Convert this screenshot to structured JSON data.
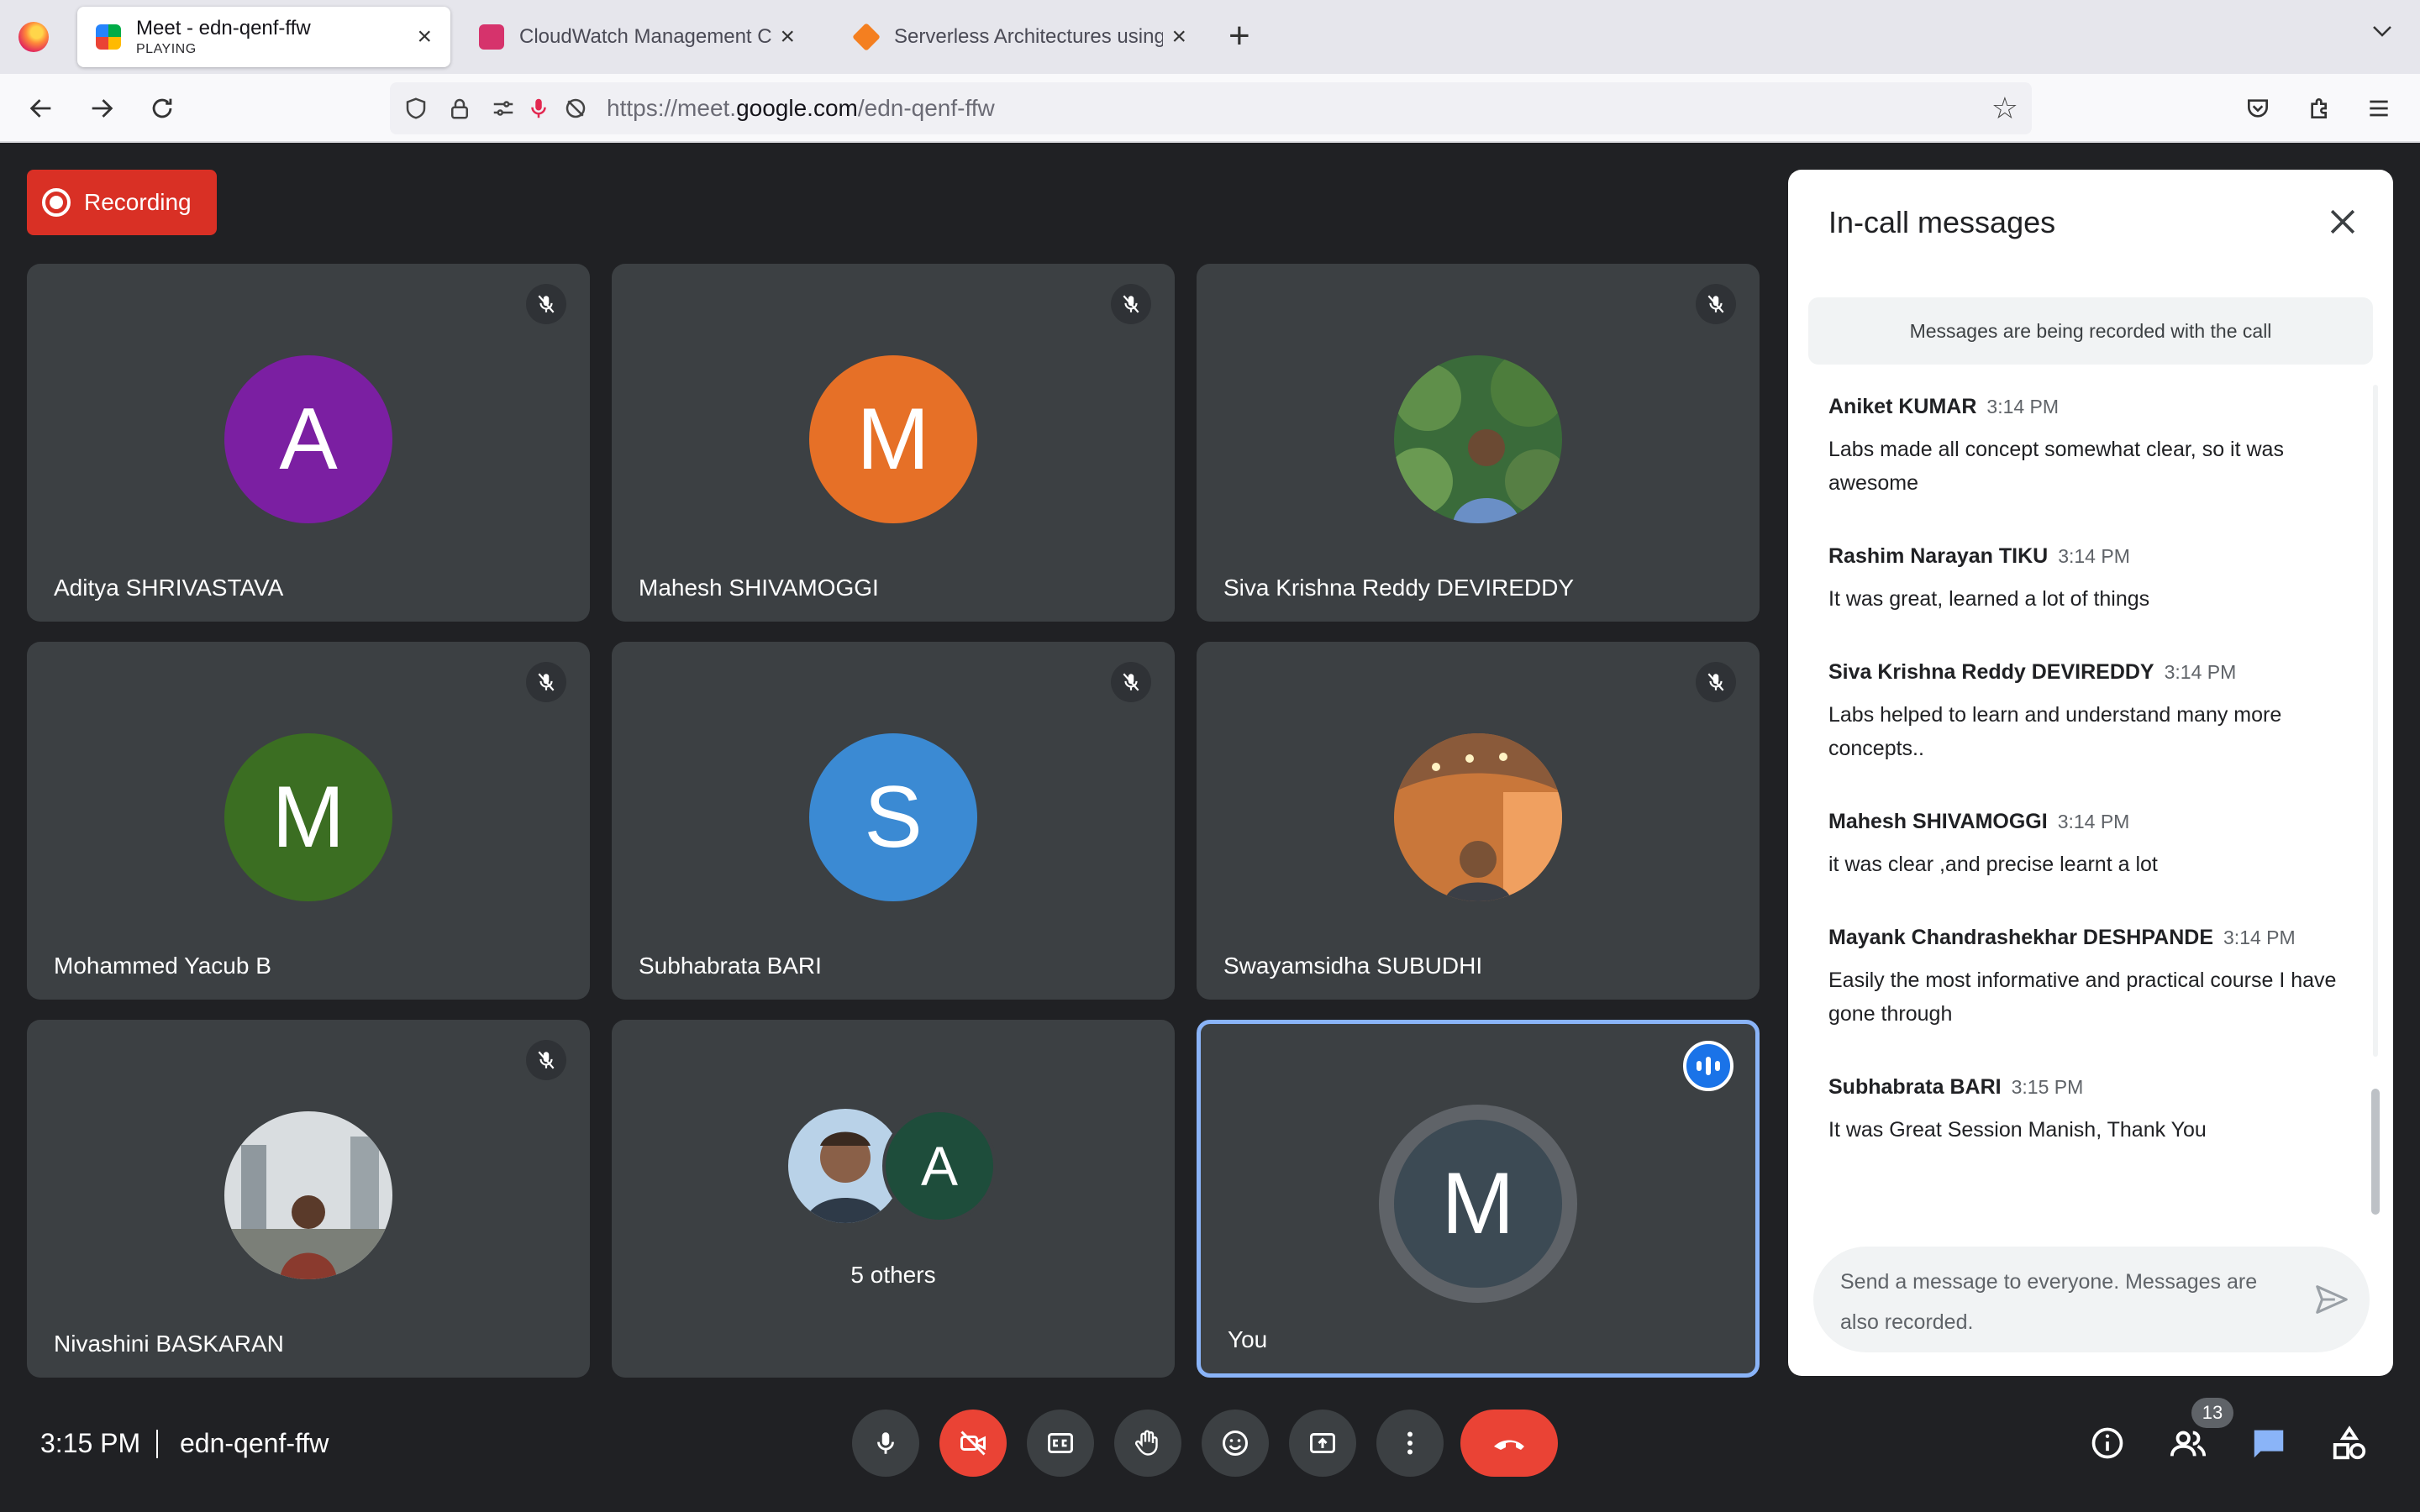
{
  "browser": {
    "tabs": [
      {
        "title": "Meet - edn-qenf-ffw",
        "subtitle": "PLAYING"
      },
      {
        "title": "CloudWatch Management Console"
      },
      {
        "title": "Serverless Architectures using A"
      }
    ],
    "url_prefix": "https://meet.",
    "url_domain": "google.com",
    "url_path": "/edn-qenf-ffw"
  },
  "meet": {
    "recording_label": "Recording",
    "participants": [
      {
        "name": "Aditya SHRIVASTAVA",
        "initial": "A",
        "color": "#7b1fa2"
      },
      {
        "name": "Mahesh SHIVAMOGGI",
        "initial": "M",
        "color": "#e67027"
      },
      {
        "name": "Siva Krishna Reddy DEVIREDDY",
        "initial": "",
        "color": "#3a6b3a"
      },
      {
        "name": "Mohammed Yacub B",
        "initial": "M",
        "color": "#3b6e22"
      },
      {
        "name": "Subhabrata BARI",
        "initial": "S",
        "color": "#3b8ad3"
      },
      {
        "name": "Swayamsidha SUBUDHI",
        "initial": "",
        "color": "#c9773a"
      },
      {
        "name": "Nivashini BASKARAN",
        "initial": "",
        "color": "#9aa3a8"
      }
    ],
    "others": {
      "label": "5 others",
      "initial": "A",
      "color": "#1e4d3b"
    },
    "you": {
      "name": "You",
      "initial": "M"
    },
    "time": "3:15 PM",
    "meeting_code": "edn-qenf-ffw",
    "people_count": "13"
  },
  "chat": {
    "title": "In-call messages",
    "notice": "Messages are being recorded with the call",
    "messages": [
      {
        "sender": "Aniket KUMAR",
        "time": "3:14 PM",
        "text": "Labs made all concept somewhat clear, so  it was awesome"
      },
      {
        "sender": "Rashim Narayan TIKU",
        "time": "3:14 PM",
        "text": "It was great, learned a lot of things"
      },
      {
        "sender": "Siva Krishna Reddy DEVIREDDY",
        "time": "3:14 PM",
        "text": "Labs helped to learn and understand many more concepts.."
      },
      {
        "sender": "Mahesh SHIVAMOGGI",
        "time": "3:14 PM",
        "text": "it was clear ,and precise learnt a lot"
      },
      {
        "sender": "Mayank Chandrashekhar DESHPANDE",
        "time": "3:14 PM",
        "text": "Easily the most informative and practical course I have gone through"
      },
      {
        "sender": "Subhabrata BARI",
        "time": "3:15 PM",
        "text": "It was Great Session Manish, Thank You"
      }
    ],
    "placeholder": "Send a message to everyone. Messages are also recorded."
  }
}
